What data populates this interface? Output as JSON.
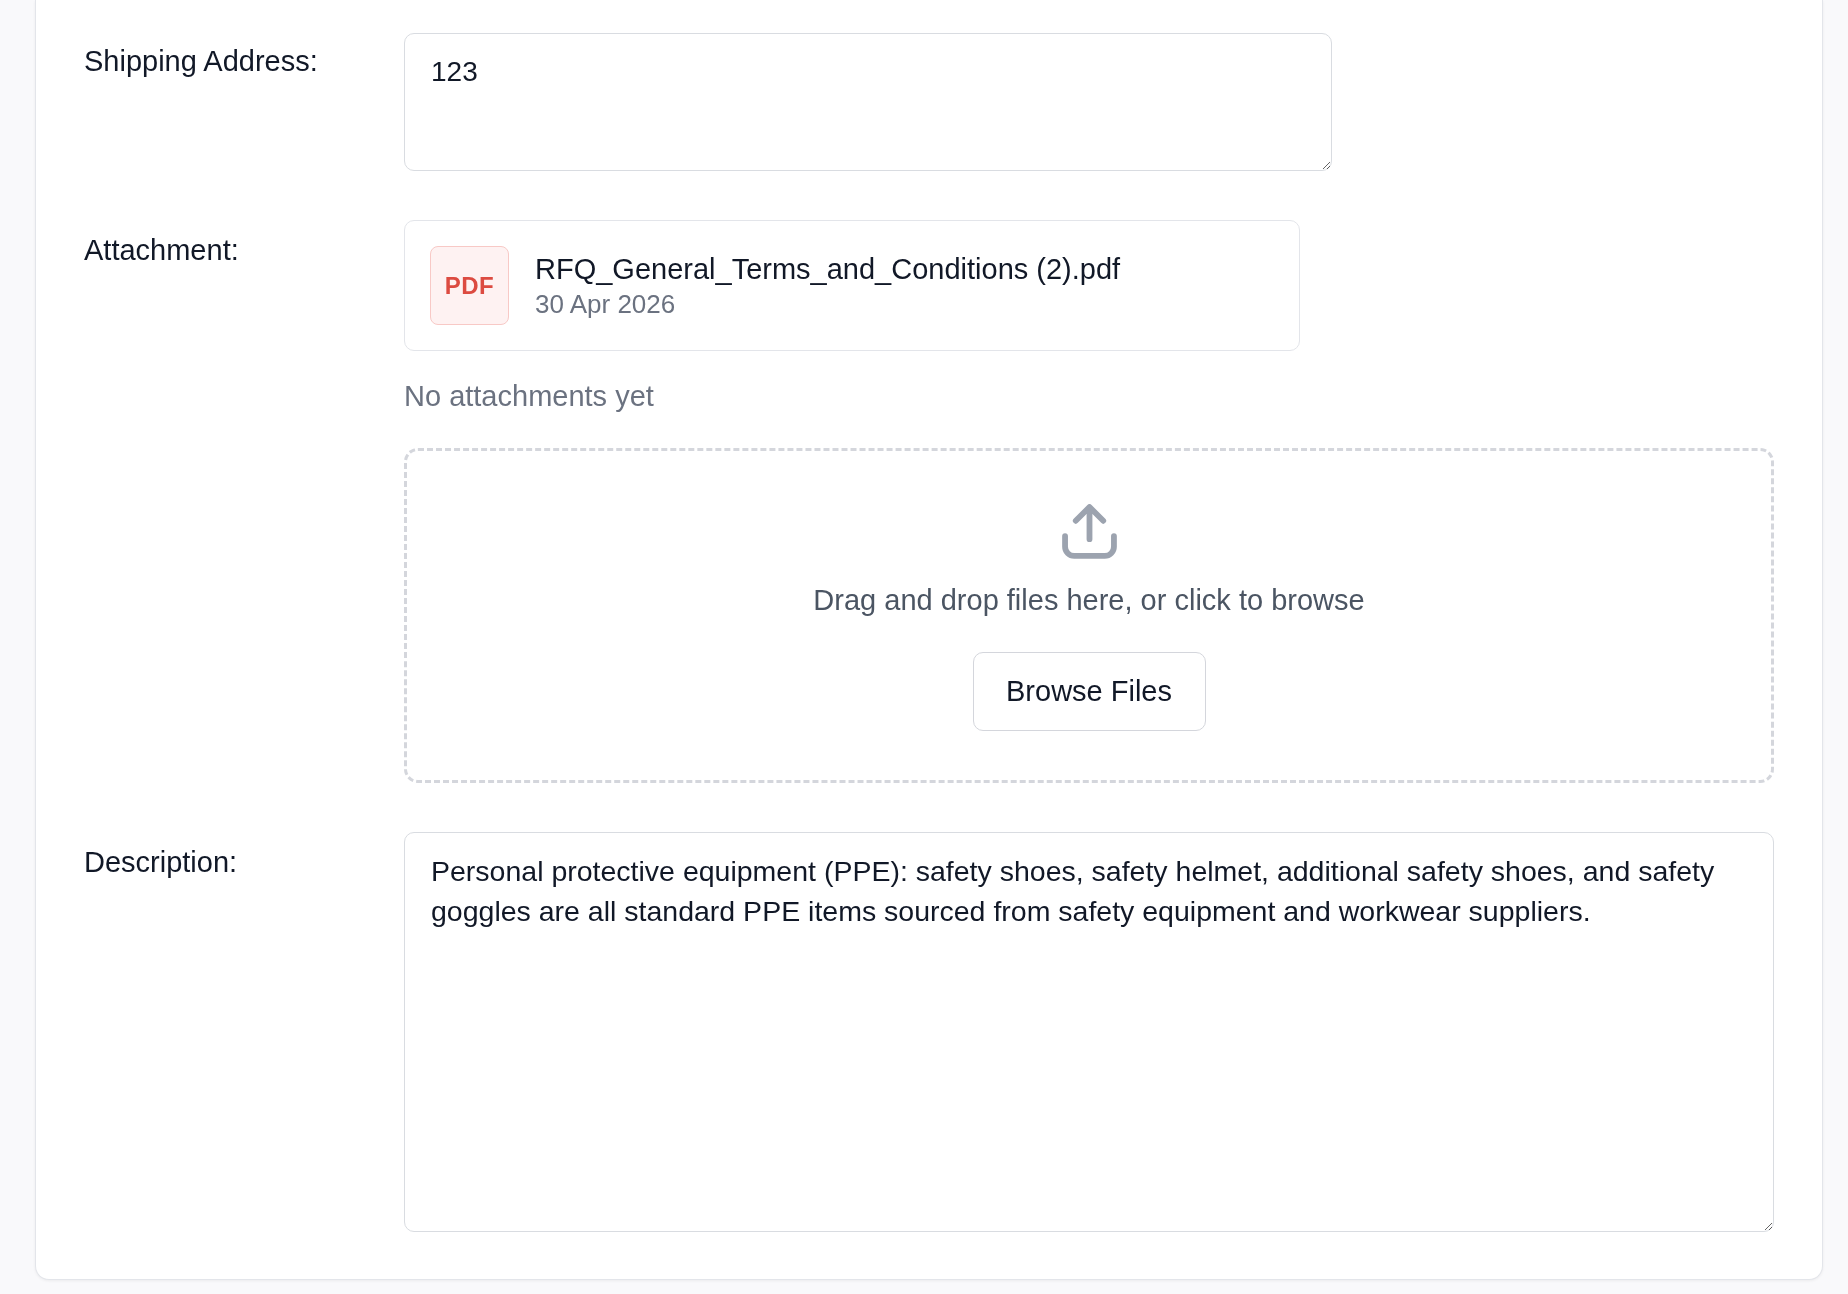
{
  "fields": [
    {
      "kind": "short_text",
      "label": "Shipping Address:",
      "value": "123"
    },
    {
      "kind": "attachments",
      "label": "Attachment:",
      "files": [
        {
          "type_badge": "PDF",
          "name": "RFQ_General_Terms_and_Conditions (2).pdf",
          "date": "30 Apr 2026"
        }
      ],
      "empty_message": "No attachments yet",
      "dropzone": {
        "prompt": "Drag and drop files here, or click to browse",
        "button": "Browse Files"
      }
    },
    {
      "kind": "long_text",
      "label": "Description:",
      "value": "Personal protective equipment (PPE): safety shoes, safety helmet, additional safety shoes, and safety goggles are all standard PPE items sourced from safety equipment and workwear suppliers."
    }
  ]
}
